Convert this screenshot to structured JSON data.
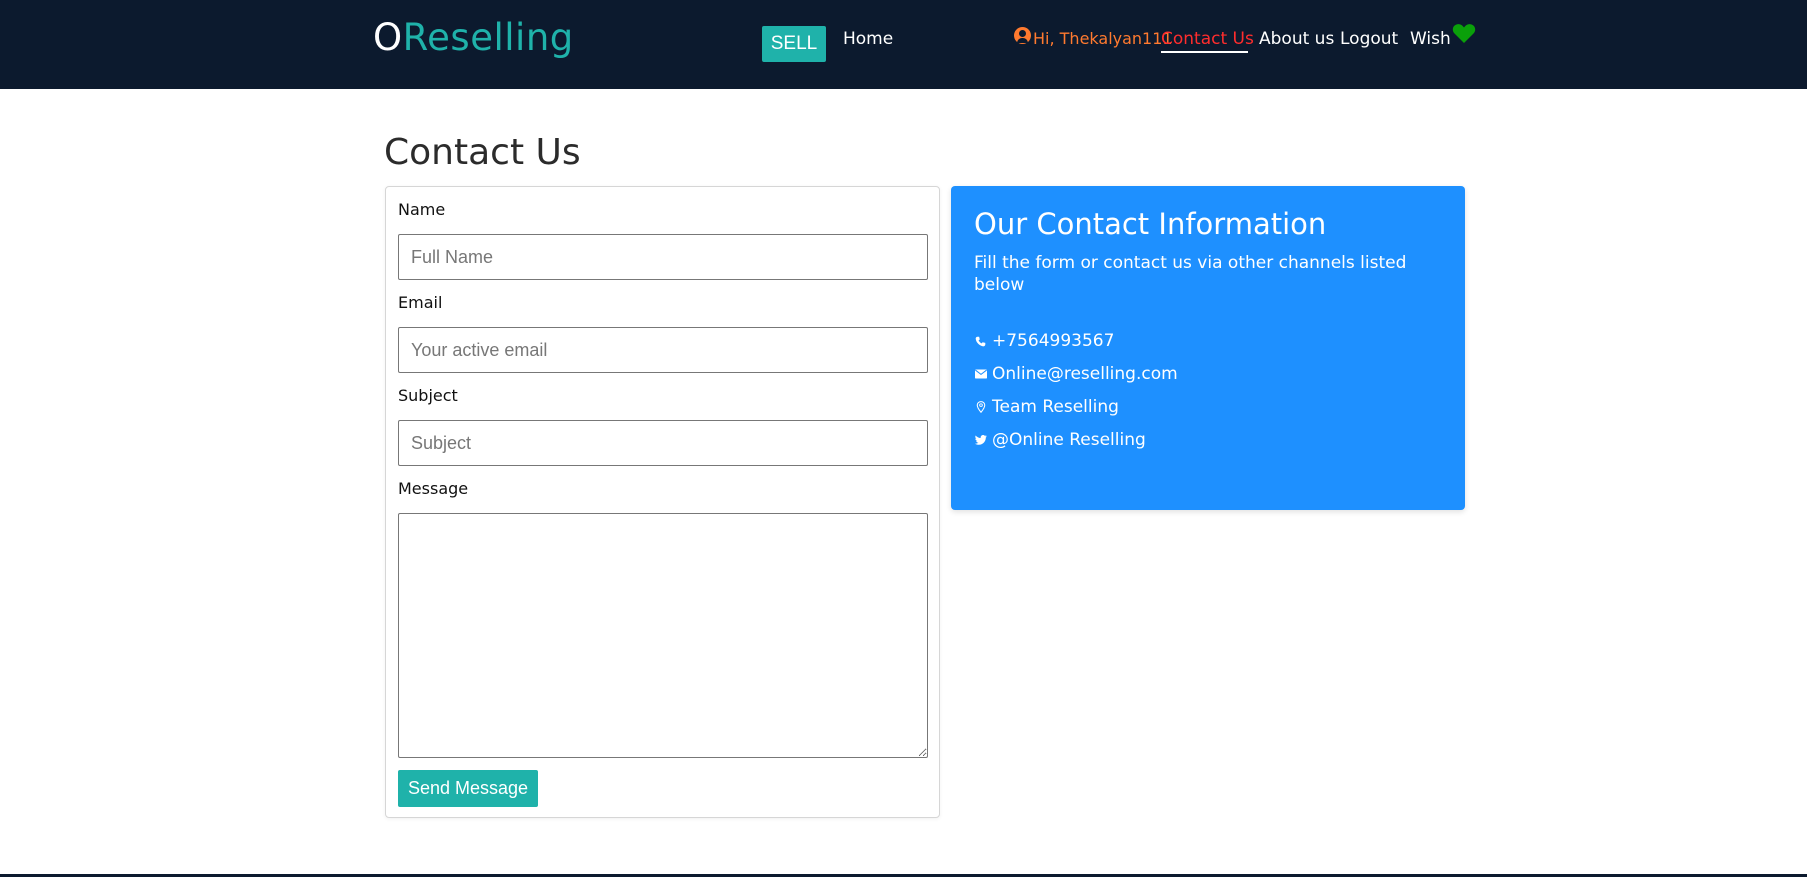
{
  "brand": {
    "first_letter": "O",
    "rest": "Reselling"
  },
  "nav": {
    "sell_label": "SELL",
    "home_label": "Home",
    "user_greeting": "Hi, Thekalyan111",
    "contact_label": "Contact Us",
    "about_label": "About us",
    "logout_label": "Logout",
    "wish_label": "Wish"
  },
  "page": {
    "title": "Contact Us"
  },
  "form": {
    "name_label": "Name",
    "name_placeholder": "Full Name",
    "email_label": "Email",
    "email_placeholder": "Your active email",
    "subject_label": "Subject",
    "subject_placeholder": "Subject",
    "message_label": "Message",
    "submit_label": "Send Message"
  },
  "contact_info": {
    "title": "Our Contact Information",
    "subtitle": "Fill the form or contact us via other channels listed below",
    "items": [
      {
        "icon": "phone-icon",
        "text": "+7564993567"
      },
      {
        "icon": "envelope-icon",
        "text": "Online@reselling.com"
      },
      {
        "icon": "map-pin-icon",
        "text": "Team Reselling"
      },
      {
        "icon": "twitter-icon",
        "text": "@Online Reselling"
      }
    ]
  },
  "colors": {
    "navbar_bg": "#0c1a2e",
    "brand_accent": "#1fb2aa",
    "user_greeting": "#ff7a2f",
    "active_link": "#ff2d2d",
    "info_card_bg": "#1e90ff",
    "heart": "#0aa00a"
  }
}
